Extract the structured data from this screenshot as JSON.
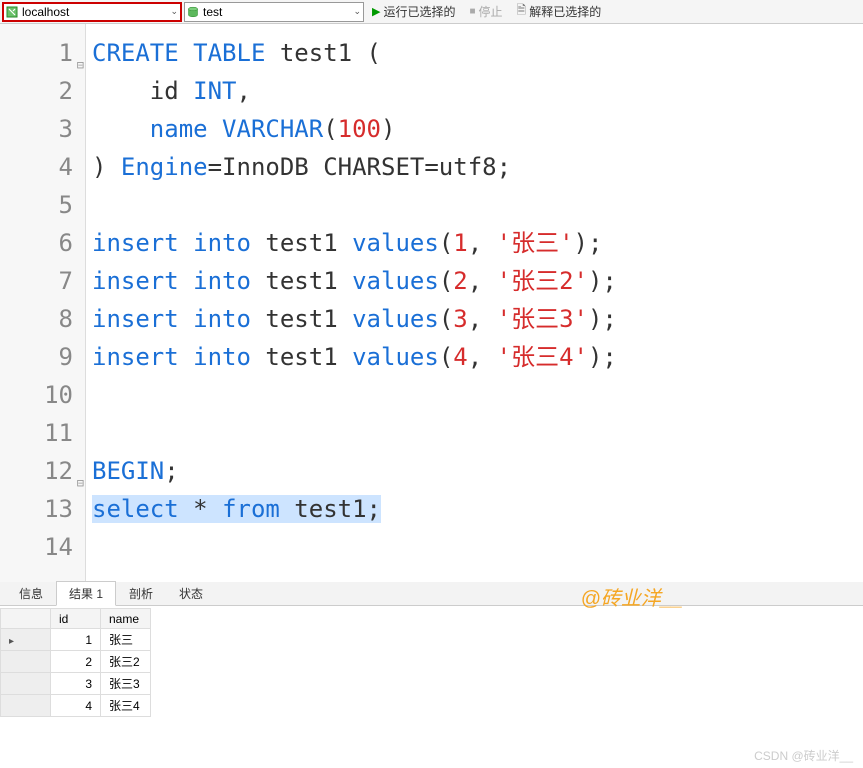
{
  "toolbar": {
    "connection": "localhost",
    "database": "test",
    "run_selected": "运行已选择的",
    "stop": "停止",
    "explain_selected": "解释已选择的"
  },
  "editor": {
    "lines": [
      {
        "n": 1,
        "html": "<span class='kw'>CREATE</span> <span class='kw'>TABLE</span> test1 (",
        "fold": "minus"
      },
      {
        "n": 2,
        "html": "    id <span class='type'>INT</span>,"
      },
      {
        "n": 3,
        "html": "    <span class='kw'>name</span> <span class='type'>VARCHAR</span>(<span class='num'>100</span>)"
      },
      {
        "n": 4,
        "html": ") <span class='kw'>Engine</span>=InnoDB CHARSET=utf8;"
      },
      {
        "n": 5,
        "html": ""
      },
      {
        "n": 6,
        "html": "<span class='kw'>insert</span> <span class='kw'>into</span> test1 <span class='kw'>values</span>(<span class='num'>1</span>, <span class='str'>'张三'</span>);"
      },
      {
        "n": 7,
        "html": "<span class='kw'>insert</span> <span class='kw'>into</span> test1 <span class='kw'>values</span>(<span class='num'>2</span>, <span class='str'>'张三2'</span>);"
      },
      {
        "n": 8,
        "html": "<span class='kw'>insert</span> <span class='kw'>into</span> test1 <span class='kw'>values</span>(<span class='num'>3</span>, <span class='str'>'张三3'</span>);"
      },
      {
        "n": 9,
        "html": "<span class='kw'>insert</span> <span class='kw'>into</span> test1 <span class='kw'>values</span>(<span class='num'>4</span>, <span class='str'>'张三4'</span>);"
      },
      {
        "n": 10,
        "html": ""
      },
      {
        "n": 11,
        "html": ""
      },
      {
        "n": 12,
        "html": "<span class='kw'>BEGIN</span>;",
        "fold": "minus"
      },
      {
        "n": 13,
        "html": "<span class='sel'><span class='kw'>select</span> * <span class='kw'>from</span> test1;</span>"
      },
      {
        "n": 14,
        "html": ""
      }
    ]
  },
  "tabs": {
    "info": "信息",
    "result1": "结果 1",
    "profile": "剖析",
    "status": "状态"
  },
  "result": {
    "columns": [
      "id",
      "name"
    ],
    "rows": [
      {
        "id": "1",
        "name": "张三"
      },
      {
        "id": "2",
        "name": "张三2"
      },
      {
        "id": "3",
        "name": "张三3"
      },
      {
        "id": "4",
        "name": "张三4"
      }
    ]
  },
  "watermark": "@砖业洋__",
  "watermark2": "CSDN @砖业洋__"
}
